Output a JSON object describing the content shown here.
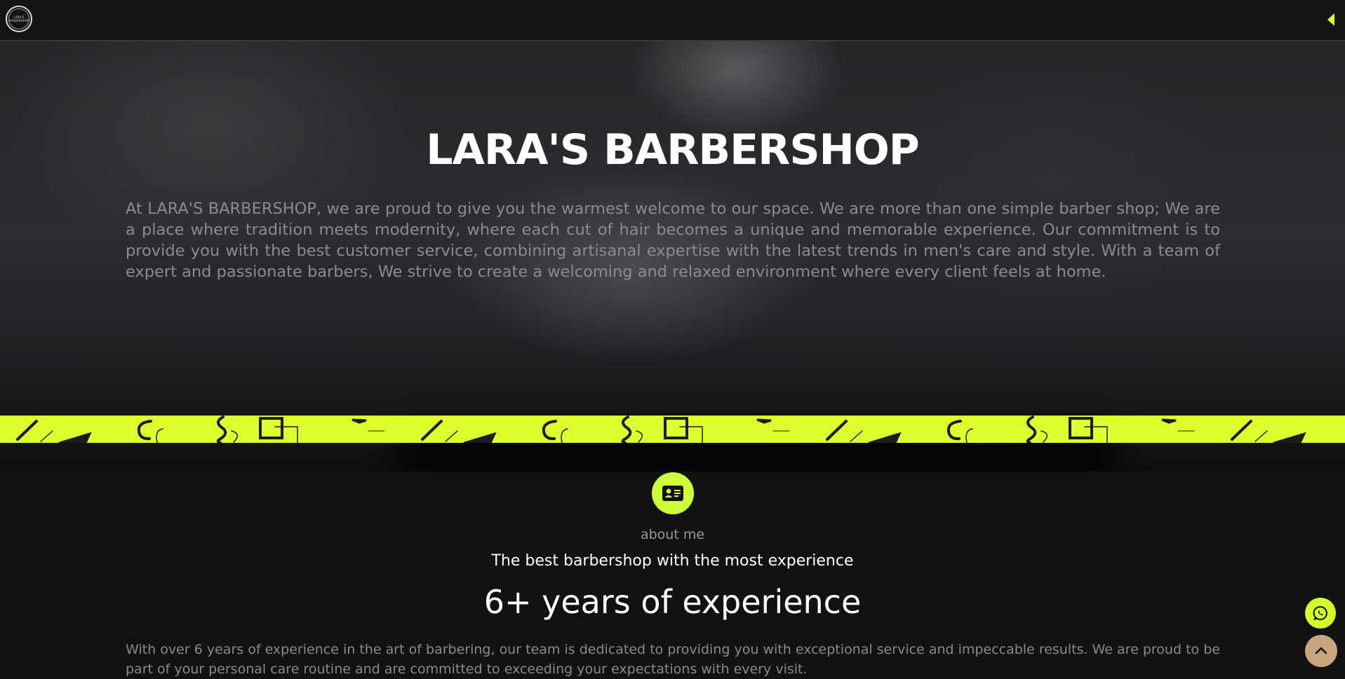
{
  "header": {
    "logo_text": "LARA'S BARBERSHOP",
    "logo_icon": "barbershop-logo",
    "menu_icon": "caret-left-icon"
  },
  "hero": {
    "title": "LARA'S BARBERSHOP",
    "description": "At LARA'S BARBERSHOP, we are proud to give you the warmest welcome to our space. We are more than one simple barber shop; We are a place where tradition meets modernity, where each cut of hair becomes a unique and memorable experience. Our commitment is to provide you with the best customer service, combining artisanal expertise with the latest trends in men's care and style. With a team of expert and passionate barbers, We strive to create a welcoming and relaxed environment where every client feels at home."
  },
  "about": {
    "icon": "id-card-icon",
    "label": "about me",
    "subtitle": "The best barbershop with the most experience",
    "heading": "6+ years of experience",
    "text": "With over 6 years of experience in the art of barbering, our team is dedicated to providing you with exceptional service and impeccable results. We are proud to be part of your personal care routine and are committed to exceeding your expectations with every visit."
  },
  "floating": {
    "whatsapp_icon": "whatsapp-icon",
    "scroll_top_icon": "chevron-up-icon"
  },
  "colors": {
    "accent": "#dcff2e",
    "background": "#121214",
    "scroll_top": "#c8a57c"
  }
}
